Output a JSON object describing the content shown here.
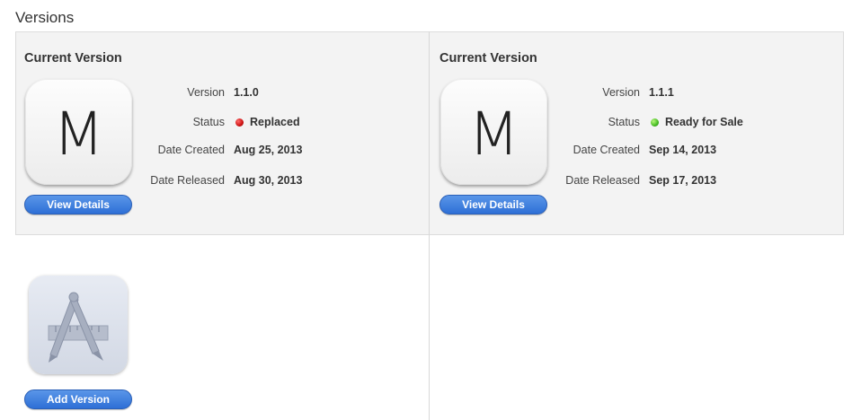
{
  "page": {
    "heading": "Versions"
  },
  "versions": [
    {
      "title": "Current Version",
      "icon_letter": "M",
      "version_label": "Version",
      "version": "1.1.0",
      "status_label": "Status",
      "status": "Replaced",
      "status_color": "#cc1111",
      "created_label": "Date Created",
      "created": "Aug 25, 2013",
      "released_label": "Date Released",
      "released": "Aug 30, 2013",
      "button": "View Details"
    },
    {
      "title": "Current Version",
      "icon_letter": "M",
      "version_label": "Version",
      "version": "1.1.1",
      "status_label": "Status",
      "status": "Ready for Sale",
      "status_color": "#44bb22",
      "created_label": "Date Created",
      "created": "Sep 14, 2013",
      "released_label": "Date Released",
      "released": "Sep 17, 2013",
      "button": "View Details"
    }
  ],
  "add": {
    "icon": "app-store-icon",
    "button": "Add Version"
  },
  "colors": {
    "button": "#2e6fd6",
    "panel": "#f3f3f3"
  }
}
